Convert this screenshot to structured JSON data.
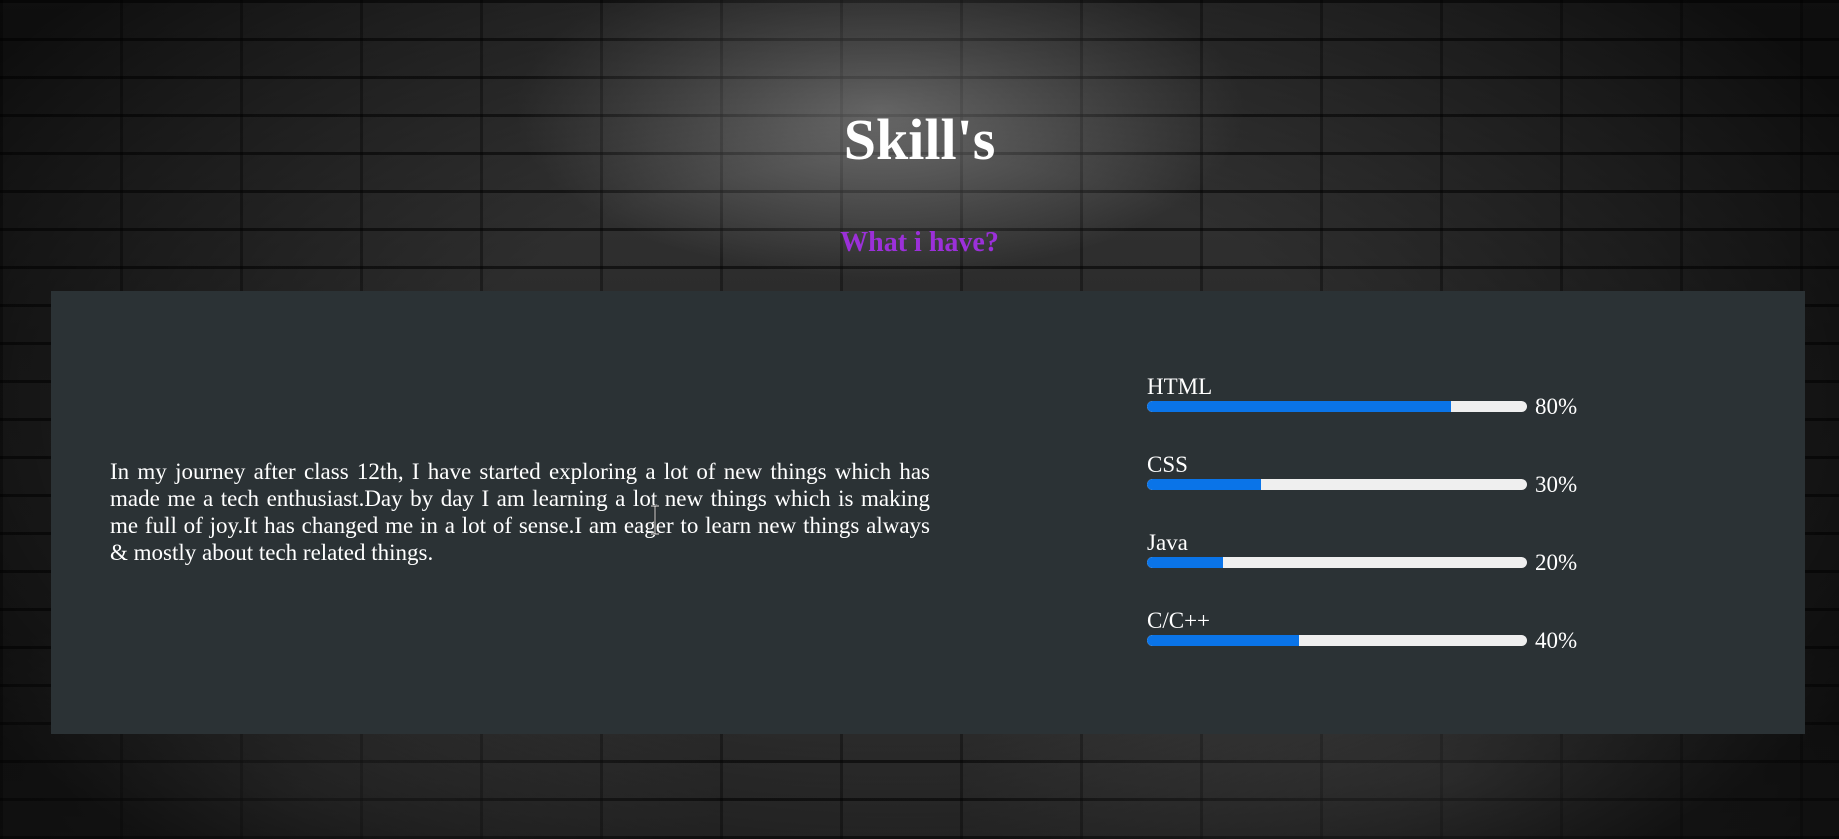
{
  "header": {
    "title": "Skill's",
    "subtitle": "What i have?"
  },
  "about": {
    "text": "In my journey after class 12th, I have started exploring a lot of new things which has made me a tech enthusiast.Day by day I am learning a lot new things which is making me full of joy.It has changed me in a lot of sense.I am eager to learn new things always & mostly about tech related things."
  },
  "skills": [
    {
      "name": "HTML",
      "percent_label": "80%",
      "value": 80
    },
    {
      "name": "CSS",
      "percent_label": "30%",
      "value": 30
    },
    {
      "name": "Java",
      "percent_label": "20%",
      "value": 20
    },
    {
      "name": "C/C++",
      "percent_label": "40%",
      "value": 40
    }
  ],
  "colors": {
    "accent": "#9b30d9",
    "bar_fill": "#0a74e8",
    "bar_track": "#efefef",
    "panel": "#2b3235"
  },
  "icons": {
    "cursor": "text-cursor-icon"
  }
}
